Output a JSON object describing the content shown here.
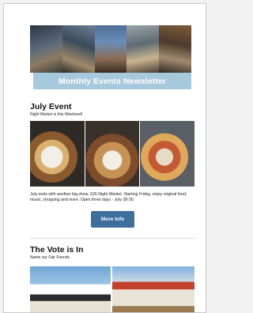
{
  "newsletter": {
    "banner_title": "Monthly Events Newsletter"
  },
  "section1": {
    "title": "July Event",
    "subtitle": "Night Market is this Weekend!",
    "body": "July ends with another big show, 626 Night Market. Starting Friday, enjoy original food, music, shopping and more. Open three days - July 28-30.",
    "button_label": "More Info"
  },
  "section2": {
    "title": "The Vote is In",
    "subtitle": "Name our Fair Friends"
  },
  "colors": {
    "banner": "#a7c9dd",
    "button": "#3d6e9c"
  }
}
